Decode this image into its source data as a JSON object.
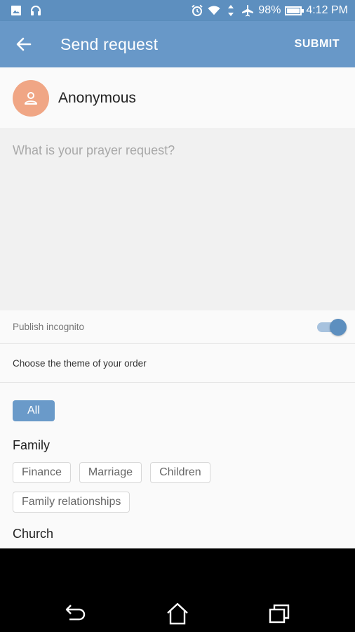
{
  "status_bar": {
    "battery": "98%",
    "time": "4:12 PM",
    "battery_level": 0.98,
    "left_icons": [
      "image-icon",
      "headset-icon"
    ],
    "right_icons": [
      "alarm-icon",
      "wifi-icon",
      "data-icon",
      "airplane-icon",
      "battery-icon"
    ]
  },
  "app_bar": {
    "title": "Send request",
    "submit_label": "SUBMIT",
    "back_icon": "arrow-back-icon"
  },
  "user": {
    "name": "Anonymous",
    "avatar_icon": "person-icon"
  },
  "prayer": {
    "placeholder": "What is your prayer request?",
    "value": ""
  },
  "incognito": {
    "label": "Publish incognito",
    "enabled": true
  },
  "theme": {
    "heading": "Choose the theme of your order",
    "all_label": "All",
    "groups": [
      {
        "title": "Family",
        "chips": [
          "Finance",
          "Marriage",
          "Children",
          "Family relationships"
        ]
      },
      {
        "title": "Church",
        "chips": []
      }
    ]
  },
  "nav_bar": {
    "buttons": [
      "back-nav-icon",
      "home-icon",
      "recents-icon"
    ]
  },
  "colors": {
    "status_bar": "#5d8fbf",
    "app_bar": "#6898c8",
    "avatar": "#f0a685",
    "accent": "#6a9ac9",
    "input_bg": "#f1f1f1"
  }
}
